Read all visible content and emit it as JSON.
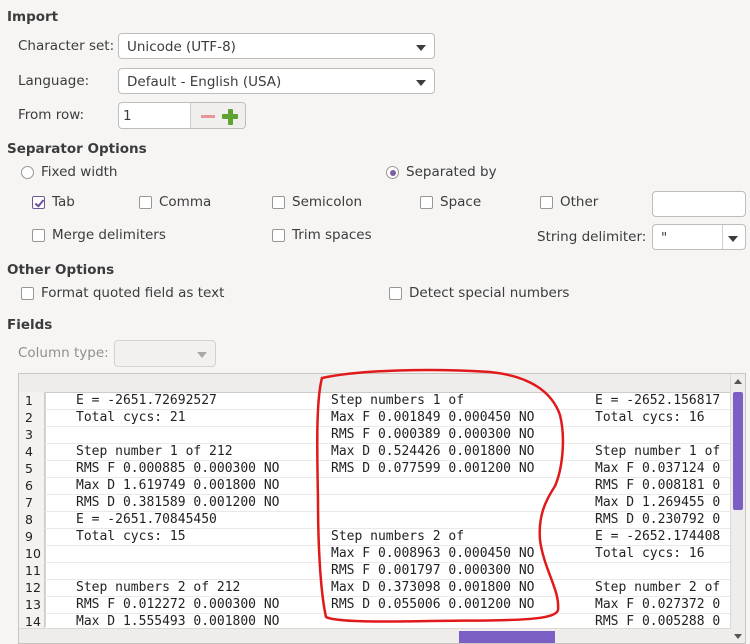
{
  "import": {
    "title": "Import",
    "charset_label": "Character set:",
    "charset_value": "Unicode (UTF-8)",
    "language_label": "Language:",
    "language_value": "Default - English (USA)",
    "from_row_label": "From row:",
    "from_row_value": "1"
  },
  "separator": {
    "title": "Separator Options",
    "fixed_width": "Fixed width",
    "separated_by": "Separated by",
    "tab": "Tab",
    "comma": "Comma",
    "semicolon": "Semicolon",
    "space": "Space",
    "other": "Other",
    "merge": "Merge delimiters",
    "trim": "Trim spaces",
    "string_delim_label": "String delimiter:",
    "string_delim_value": "\""
  },
  "other_options": {
    "title": "Other Options",
    "format_quoted": "Format quoted field as text",
    "detect_special": "Detect special numbers"
  },
  "fields": {
    "title": "Fields",
    "column_type_label": "Column type:"
  },
  "preview": {
    "rows": [
      {
        "n": "1",
        "a": "E = -2651.72692527",
        "b": "Step numbers 1 of",
        "c": "E = -2652.156817"
      },
      {
        "n": "2",
        "a": "Total cycs: 21",
        "b": "Max F 0.001849 0.000450 NO",
        "c": "Total cycs: 16"
      },
      {
        "n": "3",
        "a": "",
        "b": "RMS F 0.000389 0.000300 NO",
        "c": ""
      },
      {
        "n": "4",
        "a": "Step number 1 of 212",
        "b": "Max D 0.524426 0.001800 NO",
        "c": "Step number 1 of"
      },
      {
        "n": "5",
        "a": "RMS F 0.000885 0.000300 NO",
        "b": "RMS D 0.077599 0.001200 NO",
        "c": "Max F 0.037124 0"
      },
      {
        "n": "6",
        "a": "Max D 1.619749 0.001800 NO",
        "b": "",
        "c": "RMS F 0.008181 0"
      },
      {
        "n": "7",
        "a": "RMS D 0.381589 0.001200 NO",
        "b": "",
        "c": "Max D 1.269455 0"
      },
      {
        "n": "8",
        "a": "E = -2651.70845450",
        "b": "",
        "c": "RMS D 0.230792 0"
      },
      {
        "n": "9",
        "a": "Total cycs: 15",
        "b": "Step numbers 2 of",
        "c": "E = -2652.174408"
      },
      {
        "n": "10",
        "a": "",
        "b": "Max F 0.008963 0.000450 NO",
        "c": "Total cycs: 16"
      },
      {
        "n": "11",
        "a": "",
        "b": "RMS F 0.001797 0.000300 NO",
        "c": ""
      },
      {
        "n": "12",
        "a": "Step numbers 2 of 212",
        "b": "Max D 0.373098 0.001800 NO",
        "c": "Step number 2 of"
      },
      {
        "n": "13",
        "a": "RMS F 0.012272 0.000300 NO",
        "b": "RMS D 0.055006 0.001200 NO",
        "c": "Max F 0.027372 0"
      },
      {
        "n": "14",
        "a": "Max D 1.555493 0.001800 NO",
        "b": "",
        "c": "RMS F 0.005288 0"
      }
    ]
  },
  "colors": {
    "accent": "#7c5fc4",
    "annotation": "#e0191b"
  }
}
